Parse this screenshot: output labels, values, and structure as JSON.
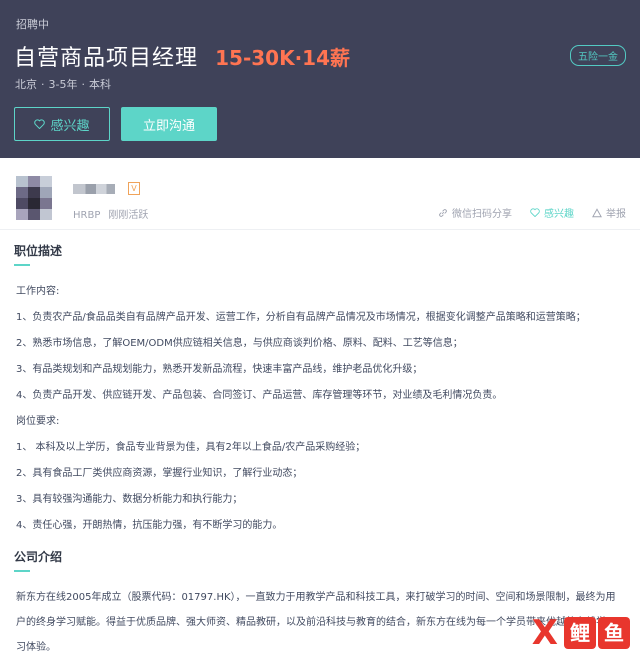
{
  "header": {
    "status": "招聘中",
    "job_title": "自营商品项目经理",
    "salary": "15-30K·14薪",
    "meta": [
      "北京",
      "3-5年",
      "本科"
    ],
    "benefit": "五险一金",
    "interest_label": "感兴趣",
    "chat_label": "立即沟通"
  },
  "recruiter": {
    "badge": "V",
    "role": "HRBP",
    "activity": "刚刚活跃",
    "actions": {
      "share": "微信扫码分享",
      "interest": "感兴趣",
      "report": "举报"
    }
  },
  "job_description": {
    "title": "职位描述",
    "lines": [
      "工作内容:",
      "1、负责农产品/食品品类自有品牌产品开发、运营工作，分析自有品牌产品情况及市场情况，根据变化调整产品策略和运营策略；",
      "2、熟悉市场信息，了解OEM/ODM供应链相关信息，与供应商谈判价格、原料、配料、工艺等信息；",
      "3、有品类规划和产品规划能力，熟悉开发新品流程，快速丰富产品线，维护老品优化升级；",
      "4、负责产品开发、供应链开发、产品包装、合同签订、产品运营、库存管理等环节，对业绩及毛利情况负责。",
      "岗位要求:",
      "1、 本科及以上学历，食品专业背景为佳，具有2年以上食品/农产品采购经验；",
      "2、具有食品工厂类供应商资源，掌握行业知识，了解行业动态；",
      "3、具有较强沟通能力、数据分析能力和执行能力；",
      "4、责任心强，开朗热情，抗压能力强，有不断学习的能力。"
    ]
  },
  "company": {
    "title": "公司介绍",
    "lines": [
      "新东方在线2005年成立（股票代码：01797.HK），一直致力于用教学产品和科技工具，来打破学习的时间、空间和场景限制，最终为用",
      "户的终身学习赋能。得益于优质品牌、强大师资、精品教研，以及前沿科技与教育的结合，新东方在线为每一个学员带来优越的在线学",
      "习体验。"
    ]
  },
  "watermark": {
    "mark": "X",
    "chars": [
      "鲤",
      "鱼"
    ]
  },
  "colors": {
    "header_bg": "#3f4259",
    "salary": "#ff7452",
    "accent": "#5dd5c8"
  }
}
